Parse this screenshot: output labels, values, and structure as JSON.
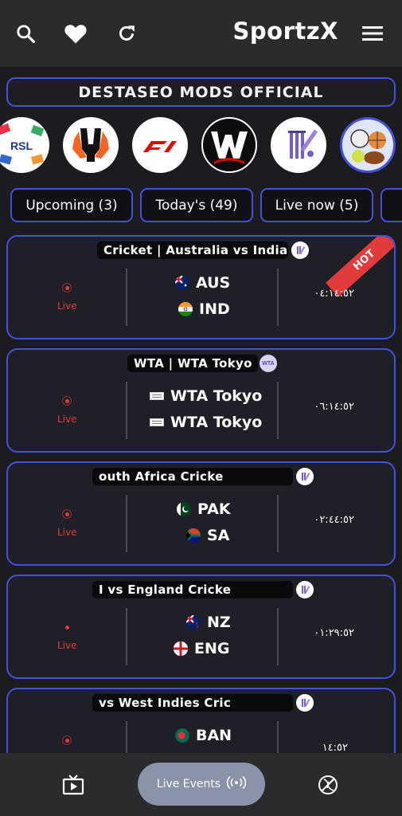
{
  "app": {
    "brand": "SportzX"
  },
  "banner": {
    "text": "DESTASEO MODS OFFICIAL"
  },
  "categories": [
    {
      "label": "RSL",
      "icon": "rsl-logo"
    },
    {
      "label": "",
      "icon": "europa-league-logo"
    },
    {
      "label": "",
      "icon": "f1-logo"
    },
    {
      "label": "",
      "icon": "wwe-logo"
    },
    {
      "label": "",
      "icon": "cricket-icon"
    },
    {
      "label": "",
      "icon": "multi-sport-icon"
    }
  ],
  "tabs": [
    {
      "label": "Upcoming (3)"
    },
    {
      "label": "Today's (49)"
    },
    {
      "label": "Live now (5)"
    }
  ],
  "cards": [
    {
      "title": "Cricket | Australia vs India",
      "status": "Live",
      "team1": "AUS",
      "team2": "IND",
      "time": "٠٤:١٤:٥٢",
      "hot": "HOT"
    },
    {
      "title": "WTA | WTA Tokyo",
      "status": "Live",
      "team1": "WTA Tokyo",
      "team2": "WTA Tokyo",
      "time": "٠٦:١٤:٥٢",
      "badge": "WTA"
    },
    {
      "title": "outh Africa                    Cricke",
      "status": "Live",
      "team1": "PAK",
      "team2": "SA",
      "time": "٠٢:٤٤:٥٢"
    },
    {
      "title": "I vs England                    Cricke",
      "status": "Live",
      "team1": "NZ",
      "team2": "ENG",
      "time": "٠١:٢٩:٥٢"
    },
    {
      "title": "vs West Indies                    Cric",
      "status": "",
      "team1": "BAN",
      "team2": "",
      "time": "١٤:٥٢"
    }
  ],
  "bottom_nav": {
    "live_events": "Live Events"
  },
  "colors": {
    "accent": "#4550d8",
    "live": "#e23b3b",
    "hot": "#e23b3b",
    "pill": "#8a93a8"
  }
}
